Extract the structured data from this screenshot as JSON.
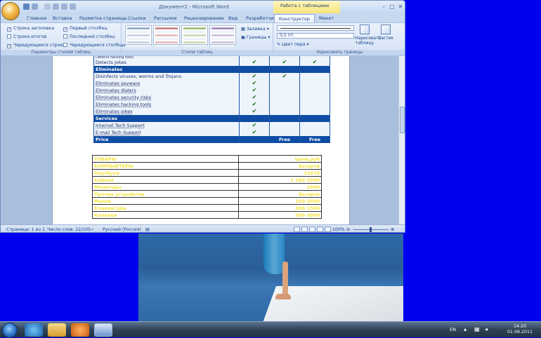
{
  "window": {
    "title": "Документ2 - Microsoft Word",
    "context_title": "Работа с таблицами",
    "controls": {
      "minimize": "–",
      "maximize": "□",
      "close": "✕"
    }
  },
  "tabs": [
    {
      "label": "Главная"
    },
    {
      "label": "Вставка"
    },
    {
      "label": "Разметка страницы"
    },
    {
      "label": "Ссылки"
    },
    {
      "label": "Рассылки"
    },
    {
      "label": "Рецензирование"
    },
    {
      "label": "Вид"
    },
    {
      "label": "Разработчик"
    },
    {
      "label": "Конструктор"
    },
    {
      "label": "Макет"
    }
  ],
  "ribbon": {
    "table_style_options": {
      "group_label": "Параметры стилей таблиц",
      "options": [
        {
          "label": "Строка заголовка",
          "checked": true
        },
        {
          "label": "Первый столбец",
          "checked": true
        },
        {
          "label": "Строка итогов",
          "checked": false
        },
        {
          "label": "Последний столбец",
          "checked": false
        },
        {
          "label": "Чередующиеся строки",
          "checked": true
        },
        {
          "label": "Чередующиеся столбцы",
          "checked": false
        }
      ]
    },
    "table_styles": {
      "group_label": "Стили таблиц",
      "shading_label": "Заливка",
      "borders_label": "Границы",
      "thumb_colors": [
        "#9bb0cf",
        "#d08c8c",
        "#a9c07f",
        "#a793c4",
        "#7fbcd0",
        "#e6a464"
      ]
    },
    "draw_borders": {
      "group_label": "Нарисовать границы",
      "line_weight": "0,5 пт.",
      "pen_color_label": "Цвет пера",
      "draw_table_label": "Нарисовать таблицу",
      "eraser_label": "Ластик"
    }
  },
  "table1": {
    "top_partial_row": "Detects hacking tools",
    "rows": [
      {
        "type": "row",
        "text": "Detects jokes",
        "ticks": [
          true,
          true,
          true
        ]
      },
      {
        "type": "header",
        "text": "Eliminates"
      },
      {
        "type": "row",
        "text": "Disinfects viruses, worms and Trojans",
        "ticks": [
          true,
          true,
          false
        ]
      },
      {
        "type": "row",
        "text": "Eliminates spyware",
        "ticks": [
          true,
          false,
          false
        ]
      },
      {
        "type": "row",
        "text": "Eliminates dialers",
        "ticks": [
          true,
          false,
          false
        ]
      },
      {
        "type": "row",
        "text": "Eliminates security risks",
        "ticks": [
          true,
          false,
          false
        ]
      },
      {
        "type": "row",
        "text": "Eliminates hacking tools",
        "ticks": [
          true,
          false,
          false
        ]
      },
      {
        "type": "row",
        "text": "Eliminates jokes",
        "ticks": [
          true,
          false,
          false
        ]
      },
      {
        "type": "header",
        "text": "Services"
      },
      {
        "type": "row",
        "text": "Internet Tech Support",
        "ticks": [
          true,
          false,
          false
        ]
      },
      {
        "type": "row",
        "text": "E-mail Tech Support",
        "ticks": [
          true,
          false,
          false
        ]
      }
    ],
    "price_row": {
      "label": "Price",
      "col2": "",
      "col3": "Free",
      "col4": "Free"
    }
  },
  "table2": {
    "rows": [
      {
        "left": "ТОВАРЫ",
        "right": "Цена,руб"
      },
      {
        "left": "КОМПЬЮТЕРЫ",
        "right": "Ассорти"
      },
      {
        "left": "Ноутбуки",
        "right": "12678"
      },
      {
        "left": "Кабели",
        "right": "1 260–3500"
      },
      {
        "left": "Мониторы",
        "right": "2900"
      },
      {
        "left": "Прочие устройства",
        "right": "Ассорти"
      },
      {
        "left": "Мыши",
        "right": "150–2000"
      },
      {
        "left": "Клавиатуры",
        "right": "300–1500"
      },
      {
        "left": "Колонки",
        "right": "500–3000"
      }
    ]
  },
  "statusbar": {
    "page": "Страница: 1 из 1",
    "words": "Число слов: 22/105",
    "language": "Русский (Россия)",
    "zoom": "100%"
  },
  "taskbar": {
    "language": "EN",
    "time": "14:20",
    "date": "01.06.2011"
  }
}
